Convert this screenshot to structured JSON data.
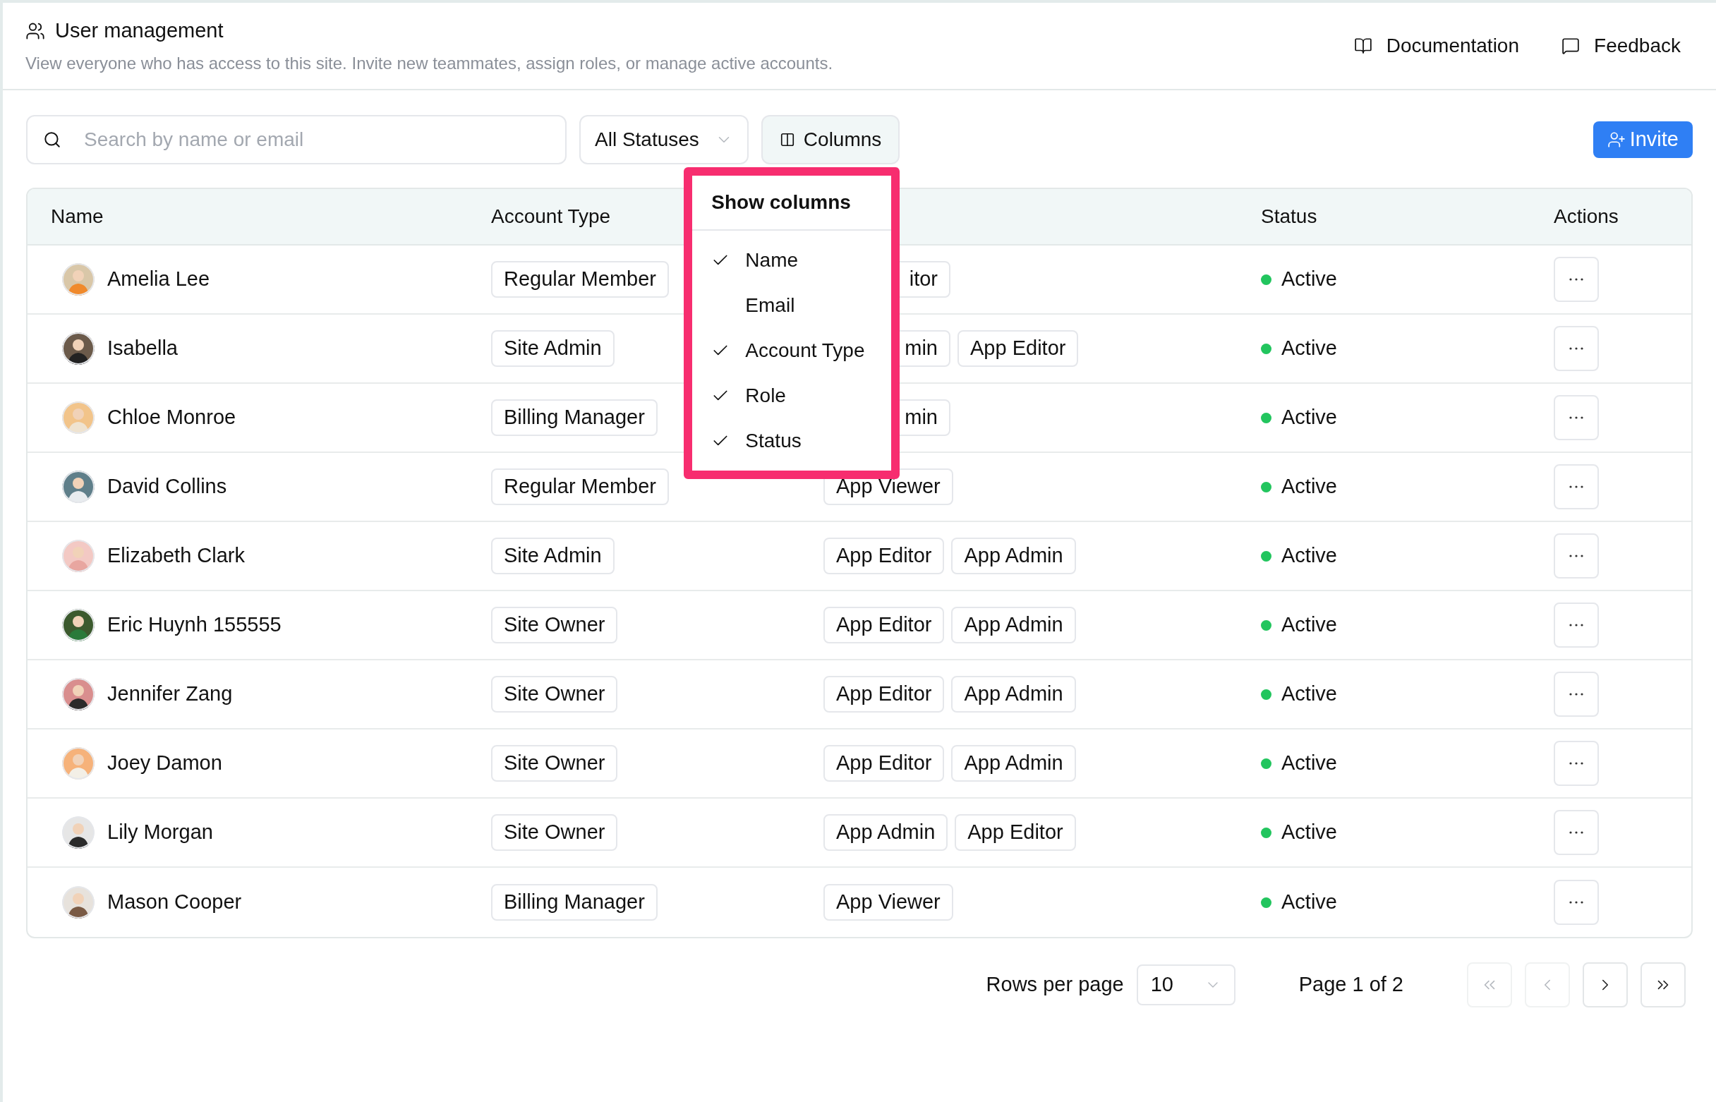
{
  "header": {
    "title": "User management",
    "description": "View everyone who has access to this site. Invite new teammates, assign roles, or manage active accounts.",
    "links": [
      {
        "label": "Documentation",
        "kind": "book"
      },
      {
        "label": "Feedback",
        "kind": "message"
      }
    ]
  },
  "toolbar": {
    "search": {
      "placeholder": "Search by name or email"
    },
    "status_filter": {
      "value": "All Statuses"
    },
    "columns_button": {
      "label": "Columns",
      "expanded": true
    },
    "invite_button": {
      "label": "Invite"
    }
  },
  "columns_menu": {
    "title": "Show columns",
    "items": [
      {
        "label": "Name",
        "checked": true
      },
      {
        "label": "Email",
        "checked": false
      },
      {
        "label": "Account Type",
        "checked": true
      },
      {
        "label": "Role",
        "checked": true
      },
      {
        "label": "Status",
        "checked": true
      }
    ]
  },
  "table": {
    "columns": [
      "Name",
      "Account Type",
      "",
      "Status",
      "Actions"
    ],
    "rows": [
      {
        "name": "Amelia Lee",
        "account_type": "Regular Member",
        "roles": [
          {
            "label": "itor",
            "clipped": true
          }
        ],
        "status": "Active"
      },
      {
        "name": "Isabella",
        "account_type": "Site Admin",
        "roles": [
          {
            "label": "min",
            "clipped": true
          },
          {
            "label": "App Editor",
            "clipped": false
          }
        ],
        "status": "Active"
      },
      {
        "name": "Chloe Monroe",
        "account_type": "Billing Manager",
        "roles": [
          {
            "label": "min",
            "clipped": true
          }
        ],
        "status": "Active"
      },
      {
        "name": "David Collins",
        "account_type": "Regular Member",
        "roles": [
          {
            "label": "App Viewer",
            "clipped": false
          }
        ],
        "status": "Active"
      },
      {
        "name": "Elizabeth Clark",
        "account_type": "Site Admin",
        "roles": [
          {
            "label": "App Editor",
            "clipped": false
          },
          {
            "label": "App Admin",
            "clipped": false
          }
        ],
        "status": "Active"
      },
      {
        "name": "Eric Huynh 155555",
        "account_type": "Site Owner",
        "roles": [
          {
            "label": "App Editor",
            "clipped": false
          },
          {
            "label": "App Admin",
            "clipped": false
          }
        ],
        "status": "Active"
      },
      {
        "name": "Jennifer Zang",
        "account_type": "Site Owner",
        "roles": [
          {
            "label": "App Editor",
            "clipped": false
          },
          {
            "label": "App Admin",
            "clipped": false
          }
        ],
        "status": "Active"
      },
      {
        "name": "Joey Damon",
        "account_type": "Site Owner",
        "roles": [
          {
            "label": "App Editor",
            "clipped": false
          },
          {
            "label": "App Admin",
            "clipped": false
          }
        ],
        "status": "Active"
      },
      {
        "name": "Lily Morgan",
        "account_type": "Site Owner",
        "roles": [
          {
            "label": "App Admin",
            "clipped": false
          },
          {
            "label": "App Editor",
            "clipped": false
          }
        ],
        "status": "Active"
      },
      {
        "name": "Mason Cooper",
        "account_type": "Billing Manager",
        "roles": [
          {
            "label": "App Viewer",
            "clipped": false
          }
        ],
        "status": "Active"
      }
    ]
  },
  "pagination": {
    "rows_per_page_label": "Rows per page",
    "rows_per_page": "10",
    "page_label": "Page 1 of 2",
    "buttons": [
      {
        "kind": "first",
        "disabled": true
      },
      {
        "kind": "prev",
        "disabled": true
      },
      {
        "kind": "next",
        "disabled": false
      },
      {
        "kind": "last",
        "disabled": false
      }
    ]
  }
}
